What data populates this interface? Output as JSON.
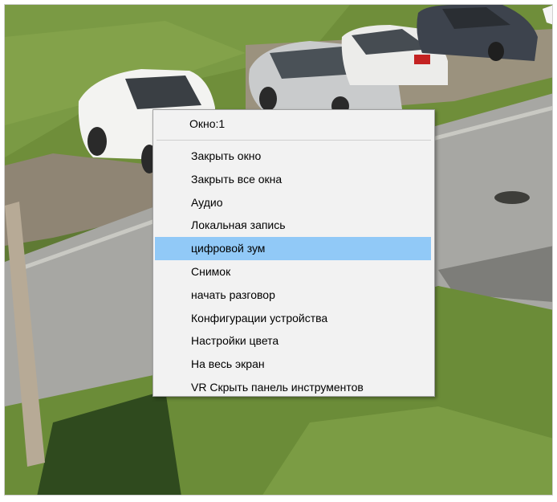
{
  "window": {
    "id_label": "Окно:1"
  },
  "menu": {
    "items": [
      {
        "label": "Закрыть окно"
      },
      {
        "label": "Закрыть все окна"
      },
      {
        "label": "Аудио"
      },
      {
        "label": "Локальная запись"
      },
      {
        "label": "цифровой зум",
        "highlighted": true
      },
      {
        "label": "Снимок"
      },
      {
        "label": "начать разговор"
      },
      {
        "label": "Конфигурации устройства"
      },
      {
        "label": "Настройки цвета"
      },
      {
        "label": "На весь экран"
      },
      {
        "label": "VR Скрыть панель инструментов"
      }
    ],
    "highlight_color": "#91c9f7",
    "background_color": "#f2f2f2"
  },
  "camera_view": {
    "scene": "parking lot with cars, grass and asphalt road"
  }
}
